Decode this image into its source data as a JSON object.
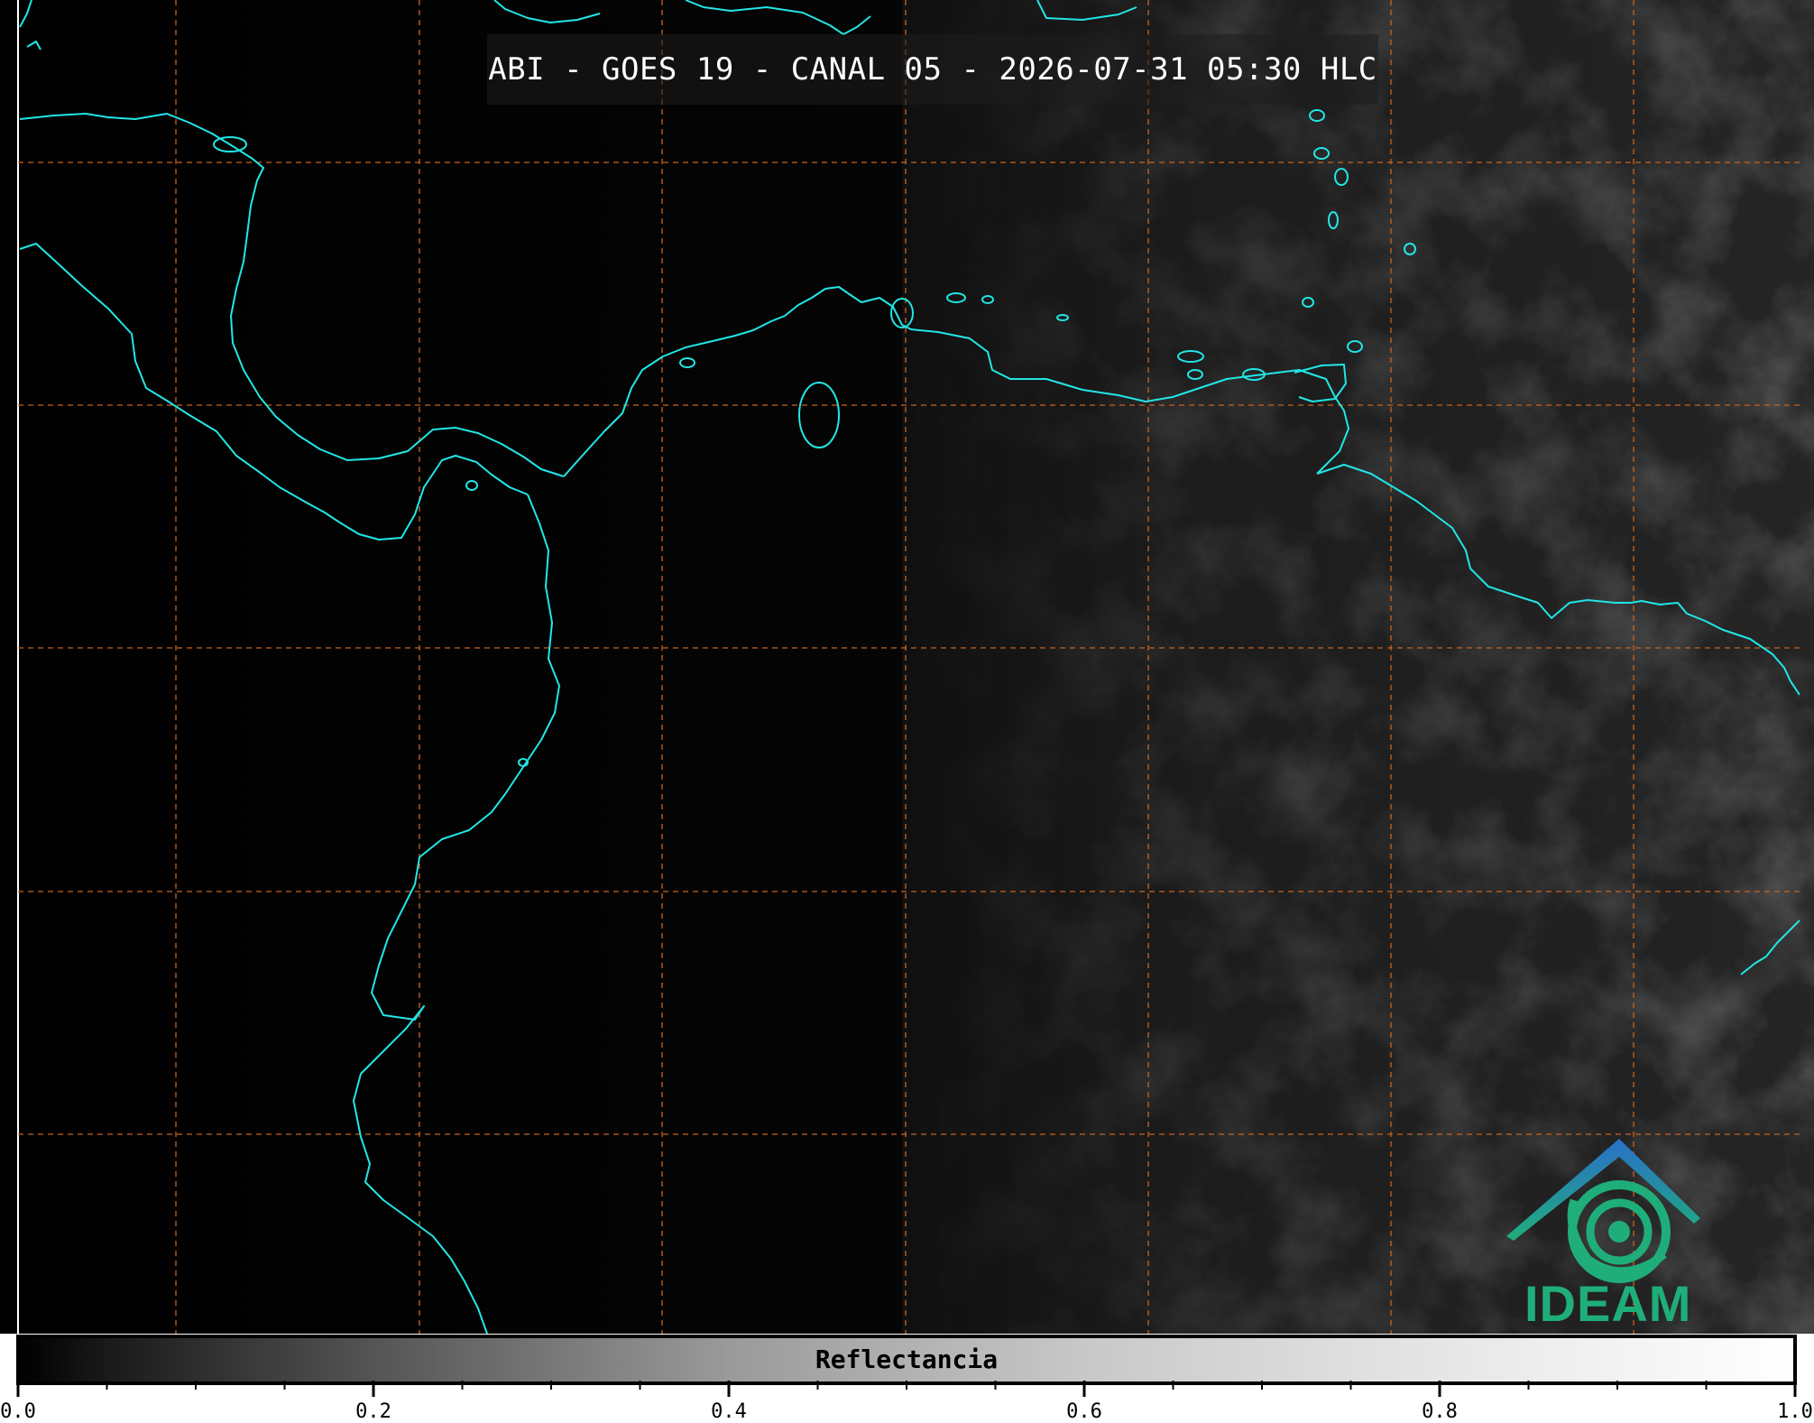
{
  "title": "ABI - GOES 19 - CANAL 05 - 2026-07-31 05:30 HLC",
  "colorbar": {
    "label": "Reflectancia",
    "range": [
      0.0,
      1.0
    ],
    "tick_labels": [
      "0.0",
      "0.2",
      "0.4",
      "0.6",
      "0.8",
      "1.0"
    ],
    "major_ticks": [
      0.0,
      0.2,
      0.4,
      0.6,
      0.8,
      1.0
    ],
    "minor_step": 0.05
  },
  "logo": {
    "text": "IDEAM",
    "icon": "ideam-mountain-swirl-icon"
  },
  "colors": {
    "coastline": "#22e6e6",
    "gridline": "#c8641e",
    "logo_blue": "#2a70c8",
    "logo_green": "#1fae7a"
  }
}
